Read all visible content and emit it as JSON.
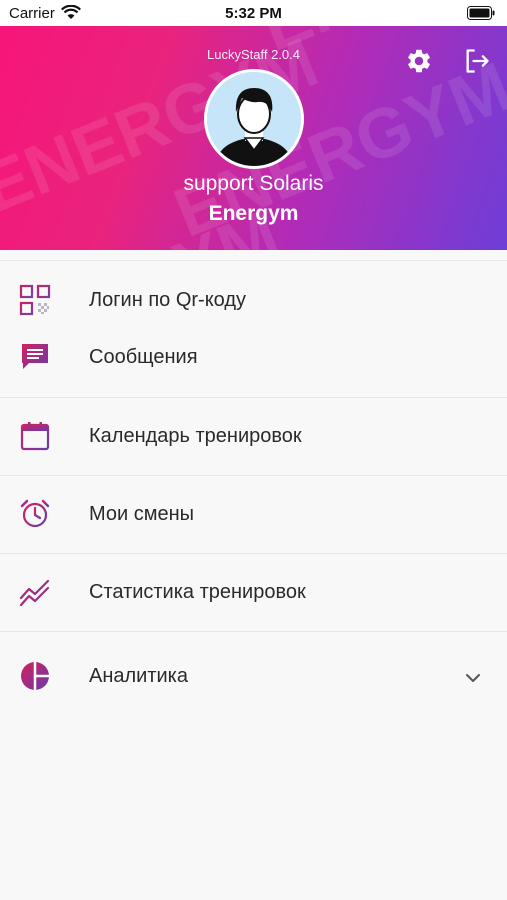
{
  "status_bar": {
    "carrier": "Carrier",
    "time": "5:32 PM"
  },
  "header": {
    "version": "LuckyStaff 2.0.4",
    "user_name": "support Solaris",
    "club_name": "Energym",
    "watermark_text": "ENERGYM"
  },
  "menu": {
    "items": [
      {
        "label": "Логин по Qr-коду",
        "icon": "qr-code-icon"
      },
      {
        "label": "Сообщения",
        "icon": "message-icon"
      },
      {
        "label": "Календарь тренировок",
        "icon": "calendar-icon"
      },
      {
        "label": "Мои смены",
        "icon": "alarm-clock-icon"
      },
      {
        "label": "Статистика тренировок",
        "icon": "chart-trend-icon"
      },
      {
        "label": "Аналитика",
        "icon": "pie-chart-icon",
        "expandable": true
      }
    ]
  },
  "colors": {
    "accent_pink": "#f7157a",
    "accent_purple": "#6d3ed8",
    "icon_color": "#b0276f"
  }
}
